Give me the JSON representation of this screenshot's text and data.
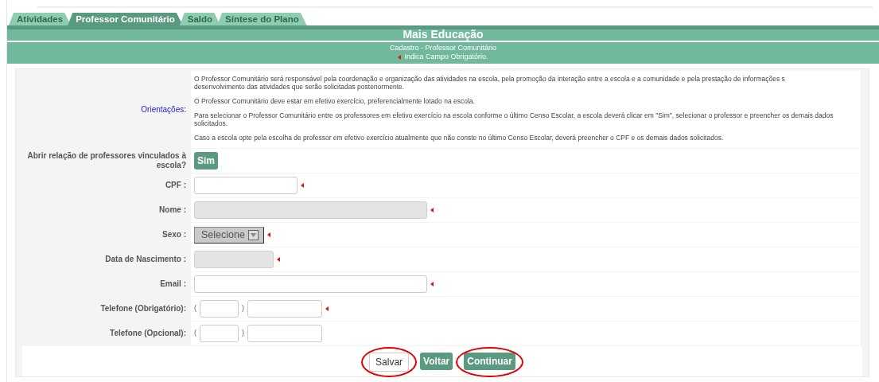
{
  "tabs": [
    {
      "label": "Atividades",
      "selected": false
    },
    {
      "label": "Professor Comunitário",
      "selected": true
    },
    {
      "label": "Saldo",
      "selected": false
    },
    {
      "label": "Síntese do Plano",
      "selected": false
    }
  ],
  "header": {
    "title": "Mais Educação",
    "subtitle": "Cadastro - Professor Comunitário",
    "required_note": "Indica Campo Obrigatório."
  },
  "orientacoes": {
    "label": "Orientações:",
    "paragraphs": [
      {
        "lines": [
          "O Professor Comunitário será responsável pela coordenação e organização das atividades na escola, pela promoção da interação entre a escola e a comunidade e pela prestação de informações s",
          "desenvolvimento das atividades que serão solicitadas posteriormente."
        ]
      },
      {
        "lines": [
          "O Professor Comunitário deve estar em efetivo exercício, preferencialmente lotado na escola."
        ]
      },
      {
        "lines": [
          "Para selecionar o Professor Comunitário entre os professores em efetivo exercício na escola conforme o último Censo Escolar, a escola deverá clicar em \"Sim\", selecionar o professor e preencher os demais dados solicitados."
        ]
      },
      {
        "lines": [
          "Caso a escola opte pela escolha de professor em efetivo exercício atualmente que não conste no último Censo Escolar, deverá preencher o CPF e os demais dados solicitados."
        ]
      }
    ]
  },
  "fields": [
    {
      "kind": "button",
      "label": "Abrir relação de professores vinculados à escola?",
      "button": "Sim"
    },
    {
      "kind": "text",
      "label": "CPF :",
      "disabled": false,
      "required": true
    },
    {
      "kind": "text",
      "label": "Nome :",
      "disabled": true,
      "required": true
    },
    {
      "kind": "select",
      "label": "Sexo :",
      "value": "Selecione",
      "required": true
    },
    {
      "kind": "text",
      "label": "Data de Nascimento :",
      "disabled": true,
      "required": true
    },
    {
      "kind": "text",
      "label": "Email :",
      "disabled": false,
      "required": true
    },
    {
      "kind": "phone",
      "label": "Telefone (Obrigatório):",
      "open": "(",
      "close": ")",
      "required": true
    },
    {
      "kind": "phone",
      "label": "Telefone (Opcional):",
      "open": "(",
      "close": ")",
      "required": false
    }
  ],
  "buttons": [
    {
      "label": "Salvar",
      "kind": "plain",
      "circled": true
    },
    {
      "label": "Voltar",
      "kind": "green",
      "circled": false
    },
    {
      "label": "Continuar",
      "kind": "green",
      "circled": true
    }
  ]
}
